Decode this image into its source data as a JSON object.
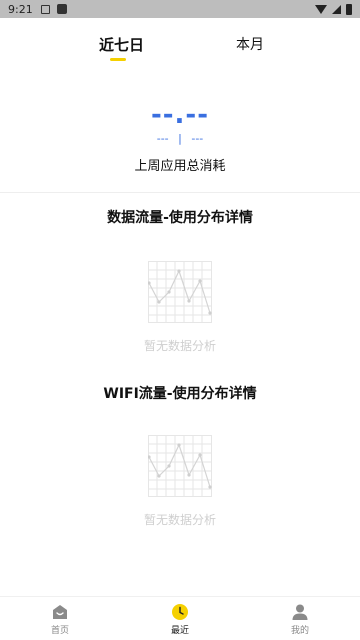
{
  "status_bar": {
    "time": "9:21"
  },
  "tabs": [
    {
      "label": "近七日",
      "active": true
    },
    {
      "label": "本月",
      "active": false
    }
  ],
  "summary": {
    "big_value": "--.--",
    "sub_left": "---",
    "sub_sep": "|",
    "sub_right": "---",
    "label": "上周应用总消耗"
  },
  "sections": [
    {
      "title": "数据流量-使用分布详情",
      "empty_text": "暂无数据分析"
    },
    {
      "title": "WIFI流量-使用分布详情",
      "empty_text": "暂无数据分析"
    }
  ],
  "bottom_nav": [
    {
      "label": "首页",
      "icon": "home-icon",
      "active": false
    },
    {
      "label": "最近",
      "icon": "clock-icon",
      "active": true
    },
    {
      "label": "我的",
      "icon": "person-icon",
      "active": false
    }
  ],
  "colors": {
    "accent": "#f5d000",
    "value_blue": "#3a6fe0",
    "empty_gray": "#cfcfcf"
  }
}
